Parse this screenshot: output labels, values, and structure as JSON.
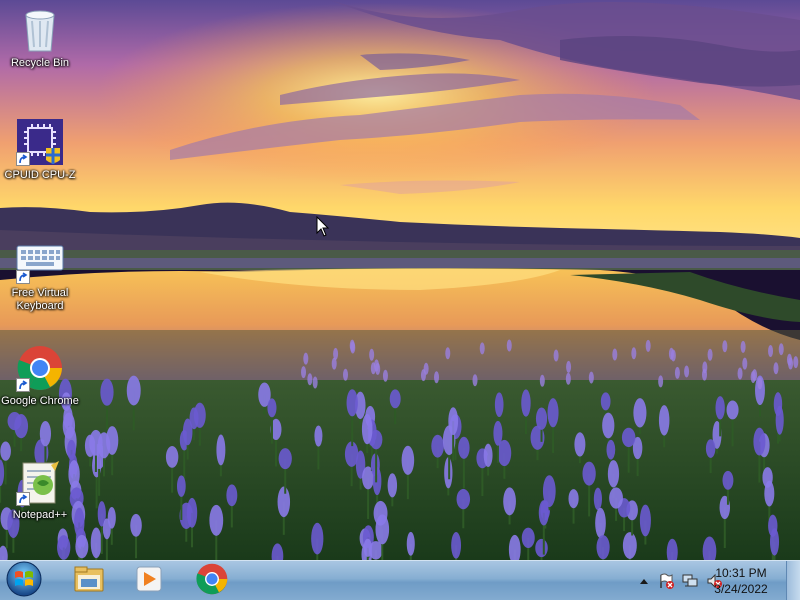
{
  "desktop": {
    "icons": [
      {
        "label": "Recycle Bin",
        "icon": "recycle-bin-icon"
      },
      {
        "label": "CPUID CPU-Z",
        "icon": "cpu-z-icon"
      },
      {
        "label": "Free Virtual Keyboard",
        "icon": "virtual-keyboard-icon"
      },
      {
        "label": "Google Chrome",
        "icon": "chrome-icon"
      },
      {
        "label": "Notepad++",
        "icon": "notepad-plus-plus-icon"
      }
    ]
  },
  "taskbar": {
    "start": {
      "icon": "windows-start-orb-icon"
    },
    "pinned": [
      {
        "name": "Windows Explorer",
        "icon": "folder-explorer-icon"
      },
      {
        "name": "Windows Media Player",
        "icon": "media-player-icon"
      },
      {
        "name": "Google Chrome",
        "icon": "chrome-icon"
      }
    ],
    "tray": {
      "icons": [
        "show-hidden-icons-chevron",
        "action-center-flag-icon",
        "network-icon",
        "volume-muted-icon"
      ],
      "time": "10:31 PM",
      "date": "3/24/2022"
    }
  },
  "colors": {
    "taskbar_top": "#a9c6e2",
    "taskbar_bottom": "#6f9cc6",
    "sky_top": "#6a4a9a",
    "sunset": "#ffd040",
    "flowers": "#7a6ae0"
  }
}
